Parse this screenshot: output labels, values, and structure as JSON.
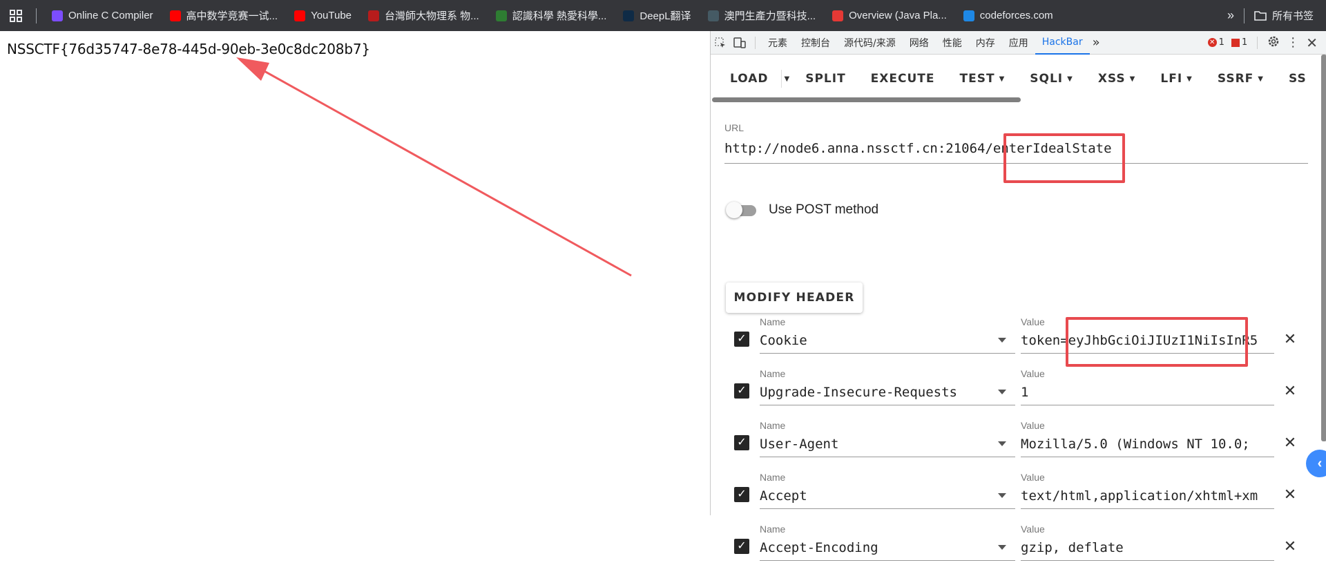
{
  "bookmarks": {
    "apps_icon": "apps-grid-icon",
    "items": [
      {
        "label": "Online C Compiler",
        "icon_color": "#7c4dff"
      },
      {
        "label": "高中数学竞赛一试...",
        "icon_color": "#ff0000"
      },
      {
        "label": "YouTube",
        "icon_color": "#ff0000"
      },
      {
        "label": "台灣師大物理系 物...",
        "icon_color": "#b71c1c"
      },
      {
        "label": "認識科學 熱愛科學...",
        "icon_color": "#2e7d32"
      },
      {
        "label": "DeepL翻译",
        "icon_color": "#0f2b46"
      },
      {
        "label": "澳門生產力暨科技...",
        "icon_color": "#455a64"
      },
      {
        "label": "Overview (Java Pla...",
        "icon_color": "#e53935"
      },
      {
        "label": "codeforces.com",
        "icon_color": "#1e88e5"
      }
    ],
    "overflow_icon": "»",
    "all_bookmarks": "所有书签"
  },
  "page": {
    "flag_text": "NSSCTF{76d35747-8e78-445d-90eb-3e0c8dc208b7}",
    "annotation_color": "#f05a5e"
  },
  "devtools": {
    "tabs": [
      "元素",
      "控制台",
      "源代码/来源",
      "网络",
      "性能",
      "内存",
      "应用",
      "HackBar"
    ],
    "active_tab": "HackBar",
    "more_tabs": "»",
    "error_count": "1",
    "issue_count": "1"
  },
  "hackbar": {
    "toolbar": {
      "load": "LOAD",
      "split": "SPLIT",
      "execute": "EXECUTE",
      "test": "TEST",
      "sqli": "SQLI",
      "xss": "XSS",
      "lfi": "LFI",
      "ssrf": "SSRF",
      "ssti_partial": "SS"
    },
    "url_label": "URL",
    "url_value": "http://node6.anna.nssctf.cn:21064/enterIdealState",
    "post_label": "Use POST method",
    "post_enabled": false,
    "modify_header": "MODIFY HEADER",
    "name_label": "Name",
    "value_label": "Value",
    "headers": [
      {
        "name": "Cookie",
        "value": "token=eyJhbGciOiJIUzI1NiIsInR5",
        "checked": true
      },
      {
        "name": "Upgrade-Insecure-Requests",
        "value": "1",
        "checked": true
      },
      {
        "name": "User-Agent",
        "value": "Mozilla/5.0 (Windows NT 10.0;",
        "checked": true
      },
      {
        "name": "Accept",
        "value": "text/html,application/xhtml+xm",
        "checked": true
      },
      {
        "name": "Accept-Encoding",
        "value": "gzip, deflate",
        "checked": true
      }
    ]
  }
}
